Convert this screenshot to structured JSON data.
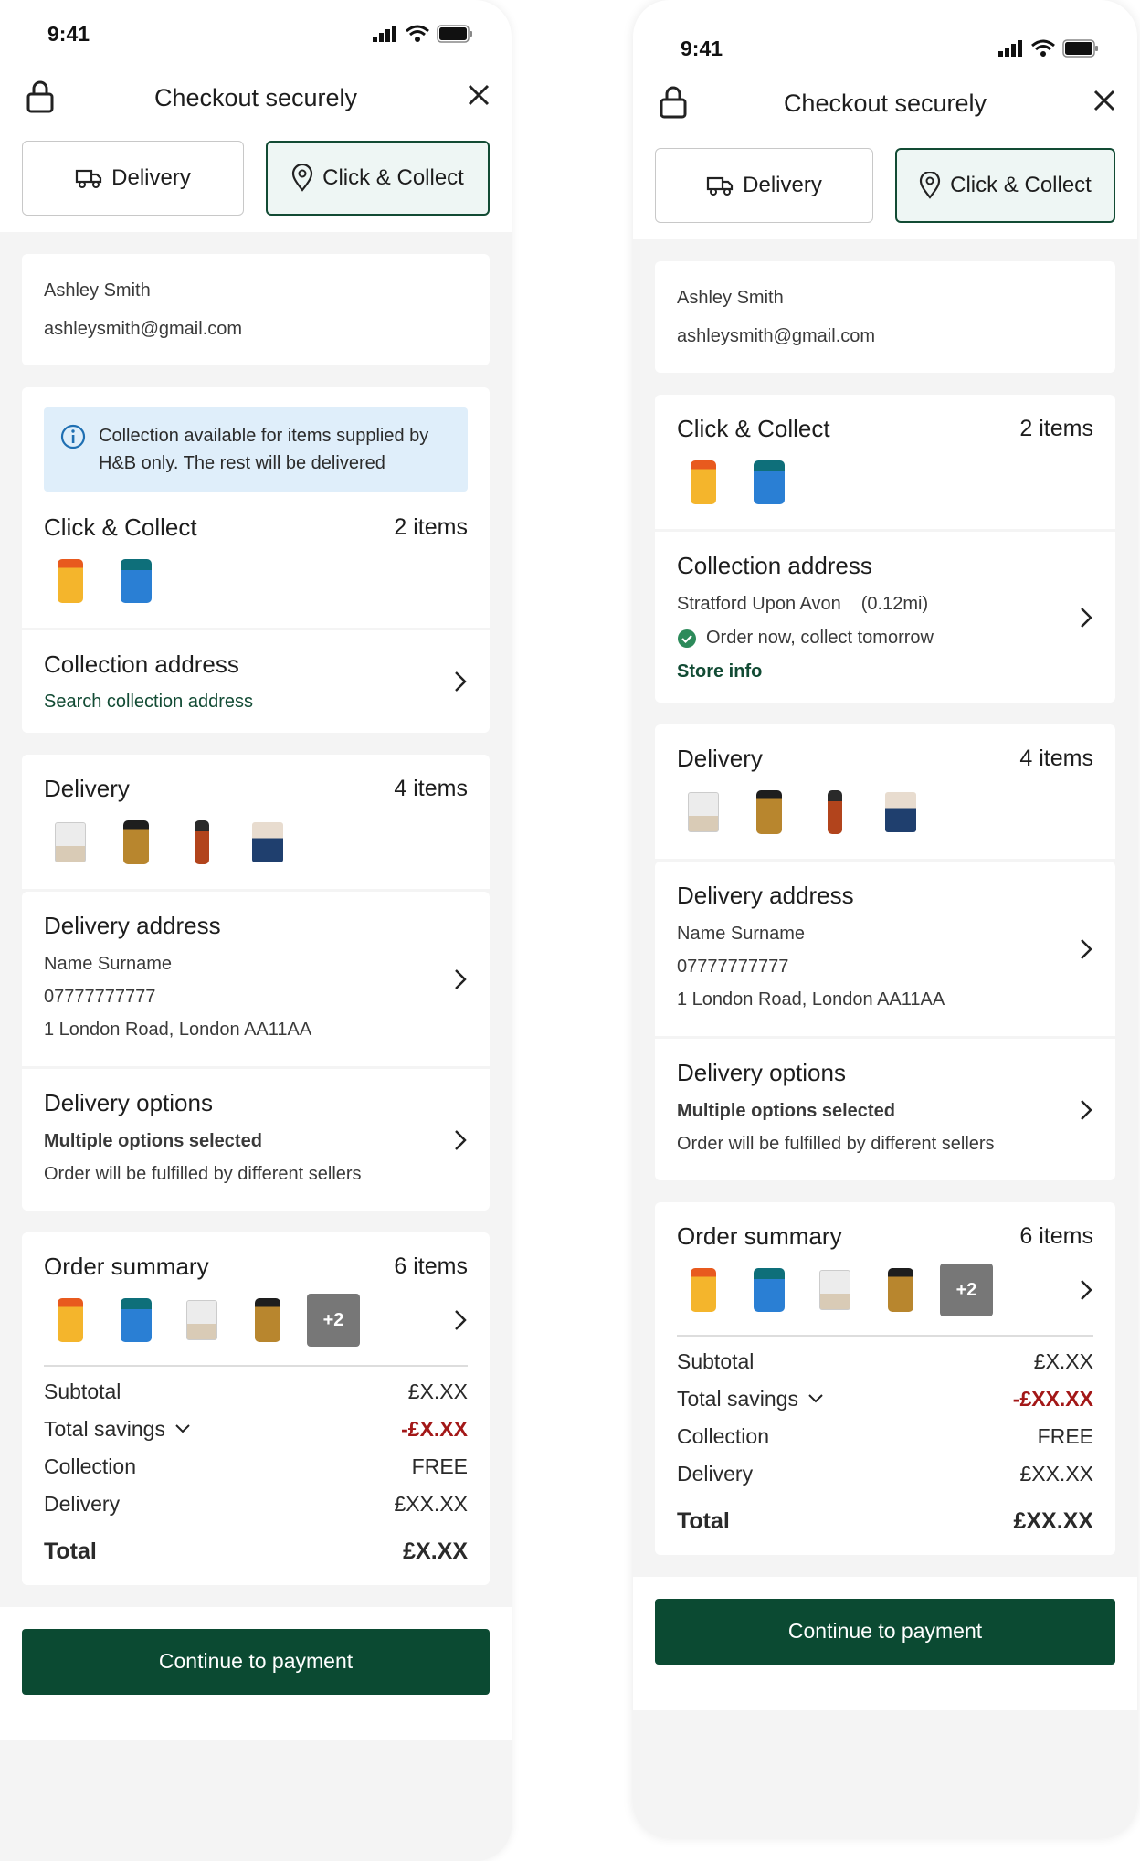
{
  "status": {
    "time": "9:41"
  },
  "header": {
    "title": "Checkout securely"
  },
  "tabs": {
    "delivery": "Delivery",
    "collect": "Click & Collect"
  },
  "customer": {
    "name": "Ashley Smith",
    "email": "ashleysmith@gmail.com"
  },
  "info_banner": "Collection available for items supplied by H&B only. The rest will be delivered",
  "click_collect": {
    "title": "Click & Collect",
    "count": "2 items"
  },
  "collection": {
    "title": "Collection address",
    "search_link": "Search collection address",
    "store": "Stratford Upon Avon",
    "distance": "(0.12mi)",
    "availability": "Order now, collect tomorrow",
    "store_info": "Store info"
  },
  "delivery_items": {
    "title": "Delivery",
    "count": "4 items"
  },
  "delivery_address": {
    "title": "Delivery address",
    "name": "Name Surname",
    "phone": "07777777777",
    "address": "1 London Road, London AA11AA"
  },
  "delivery_options": {
    "title": "Delivery options",
    "selected": "Multiple options selected",
    "note": "Order will be fulfilled by different sellers"
  },
  "order_summary": {
    "title": "Order summary",
    "count": "6 items",
    "more": "+2",
    "subtotal_label": "Subtotal",
    "subtotal_value": "£X.XX",
    "savings_label": "Total savings",
    "savings_value": "-£X.XX",
    "savings_value_b": "-£XX.XX",
    "collection_label": "Collection",
    "collection_value": "FREE",
    "delivery_label": "Delivery",
    "delivery_value": "£XX.XX",
    "total_label": "Total",
    "total_value": "£X.XX",
    "total_value_b": "£XX.XX"
  },
  "cta": {
    "label": "Continue to payment"
  },
  "colors": {
    "brand_green": "#0b4a32",
    "savings_red": "#a31818",
    "info_blue": "#dfeefa"
  }
}
